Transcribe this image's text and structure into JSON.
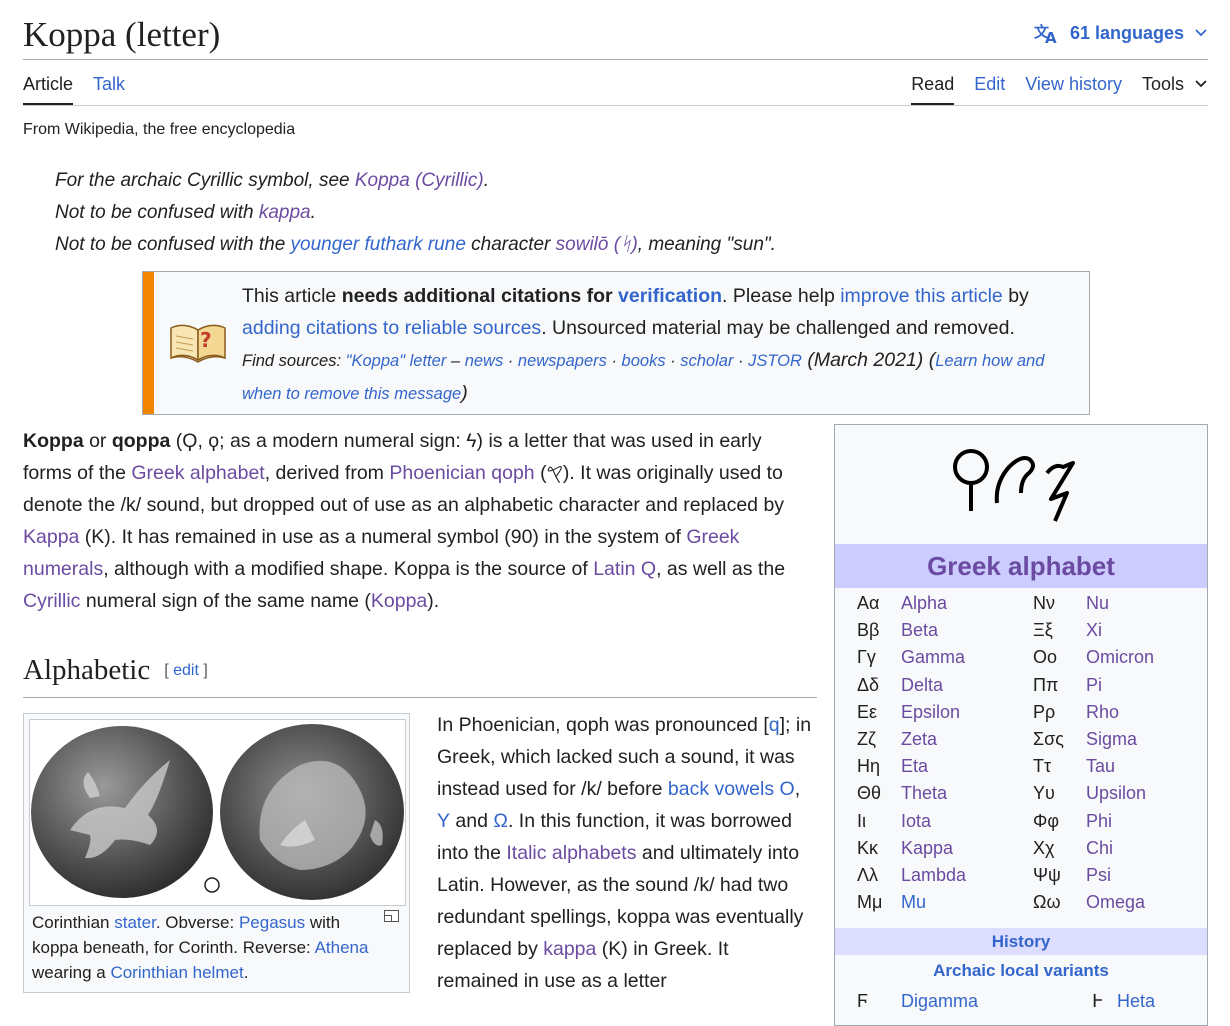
{
  "header": {
    "title": "Koppa (letter)",
    "languages_label": "61 languages",
    "tabs_left": [
      "Article",
      "Talk"
    ],
    "tabs_right": [
      "Read",
      "Edit",
      "View history",
      "Tools"
    ]
  },
  "tagline": "From Wikipedia, the free encyclopedia",
  "hatnotes": {
    "h1_pre": "For the archaic Cyrillic symbol, see ",
    "h1_link": "Koppa (Cyrillic)",
    "h1_post": ".",
    "h2_pre": "Not to be confused with ",
    "h2_link": "kappa",
    "h2_post": ".",
    "h3_pre": "Not to be confused with the ",
    "h3_link1": "younger futhark rune",
    "h3_mid": " character ",
    "h3_link2": "sowilō (ᛋ)",
    "h3_post": ", meaning \"sun\"."
  },
  "ambox": {
    "t1": "This article ",
    "t2": "needs additional citations for ",
    "t3": "verification",
    "t4": ". Please help ",
    "t5": "improve this article",
    "t6": " by ",
    "t7": "adding citations to reliable sources",
    "t8": ". Unsourced material may be challenged and removed.",
    "fs": "Find sources: ",
    "fs_q": "\"Koppa\" letter",
    "fs_dash": " – ",
    "fs_news": "news",
    "fs_newspapers": "newspapers",
    "fs_books": "books",
    "fs_scholar": "scholar",
    "fs_jstor": "JSTOR",
    "fs_date": " (March 2021) (",
    "fs_learn": "Learn how and when to remove this message",
    "fs_close": ")",
    "sep": " · "
  },
  "lead": {
    "b1": "Koppa",
    "s1": " or ",
    "b2": "qoppa",
    "s2": " (Ϙ, ϙ; as a modern numeral sign: ϟ) is a letter that was used in early forms of the ",
    "l1": "Greek alphabet",
    "s3": ", derived from ",
    "l2": "Phoenician qoph",
    "s4": " (𐤒). It was originally used to denote the /k/ sound, but dropped out of use as an alphabetic character and replaced by ",
    "l3": "Kappa",
    "s5": " (Κ). It has remained in use as a numeral symbol (90) in the system of ",
    "l4": "Greek numerals",
    "s6": ", although with a modified shape. Koppa is the source of ",
    "l5": "Latin Q",
    "s7": ", as well as the ",
    "l6": "Cyrillic",
    "s8": " numeral sign of the same name (",
    "l7": "Koppa",
    "s9": ")."
  },
  "section": {
    "title": "Alphabetic",
    "edit_open": "[ ",
    "edit": "edit",
    "edit_close": " ]"
  },
  "thumb": {
    "c1": "Corinthian ",
    "c2": "stater",
    "c3": ". Obverse: ",
    "c4": "Pegasus",
    "c5": " with koppa beneath, for Corinth. Reverse: ",
    "c6": "Athena",
    "c7": " wearing a ",
    "c8": "Corinthian helmet",
    "c9": "."
  },
  "para2": {
    "s1": "In Phoenician, qoph was pronounced [",
    "l1": "q",
    "s2": "]; in Greek, which lacked such a sound, it was instead used for /k/ before ",
    "l2": "back vowels",
    "s3": " ",
    "l3": "O",
    "s4": ", ",
    "l4": "Y",
    "s5": " and ",
    "l5": "Ω",
    "s6": ". In this function, it was borrowed into the ",
    "l6": "Italic alphabets",
    "s7": " and ultimately into Latin. However, as the sound /k/ had two redundant spellings, koppa was eventually replaced by ",
    "l7": "kappa",
    "s8": " (Κ) in Greek. It remained in use as a letter"
  },
  "infobox": {
    "glyphs": "ϘϞϟ",
    "title": "Greek alphabet",
    "left": [
      {
        "g": "Αα",
        "n": "Alpha"
      },
      {
        "g": "Ββ",
        "n": "Beta"
      },
      {
        "g": "Γγ",
        "n": "Gamma"
      },
      {
        "g": "Δδ",
        "n": "Delta"
      },
      {
        "g": "Εε",
        "n": "Epsilon"
      },
      {
        "g": "Ζζ",
        "n": "Zeta"
      },
      {
        "g": "Ηη",
        "n": "Eta"
      },
      {
        "g": "Θθ",
        "n": "Theta"
      },
      {
        "g": "Ιι",
        "n": "Iota"
      },
      {
        "g": "Κκ",
        "n": "Kappa"
      },
      {
        "g": "Λλ",
        "n": "Lambda"
      },
      {
        "g": "Μμ",
        "n": "Mu"
      }
    ],
    "right": [
      {
        "g": "Νν",
        "n": "Nu"
      },
      {
        "g": "Ξξ",
        "n": "Xi"
      },
      {
        "g": "Οο",
        "n": "Omicron"
      },
      {
        "g": "Ππ",
        "n": "Pi"
      },
      {
        "g": "Ρρ",
        "n": "Rho"
      },
      {
        "g": "Σσς",
        "n": "Sigma"
      },
      {
        "g": "Ττ",
        "n": "Tau"
      },
      {
        "g": "Υυ",
        "n": "Upsilon"
      },
      {
        "g": "Φφ",
        "n": "Phi"
      },
      {
        "g": "Χχ",
        "n": "Chi"
      },
      {
        "g": "Ψψ",
        "n": "Psi"
      },
      {
        "g": "Ωω",
        "n": "Omega"
      }
    ],
    "history": "History",
    "archaic": "Archaic local variants",
    "partial": [
      {
        "g": "Ϝ",
        "n": "Digamma"
      },
      {
        "g": "Ͱ",
        "n": "Heta"
      }
    ]
  }
}
